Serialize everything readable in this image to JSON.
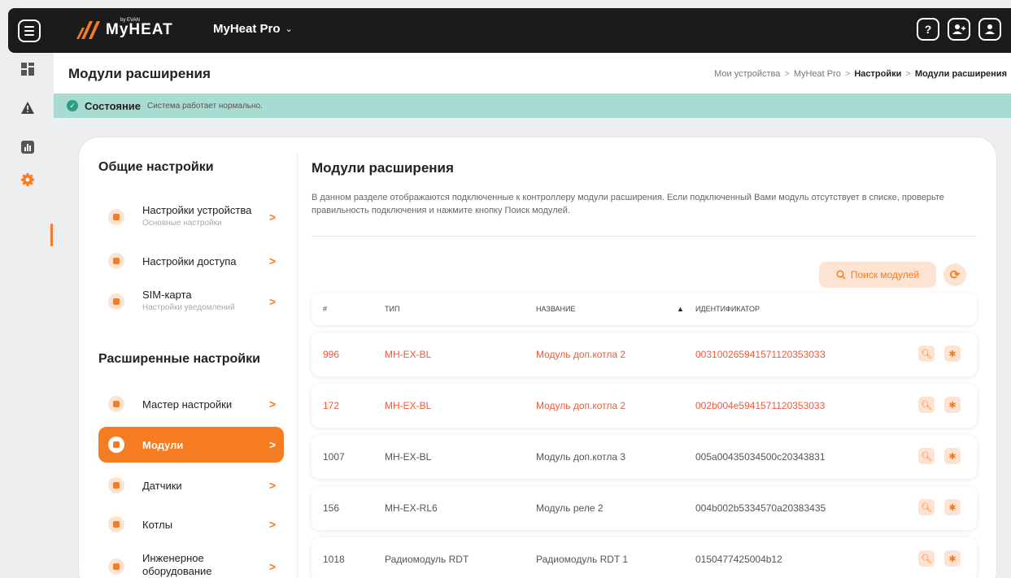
{
  "topbar": {
    "logo_text": "MyHEAT",
    "logo_sub": "by EVAN",
    "device_name": "MyHeat Pro",
    "icons": [
      "menu-icon",
      "help-icon",
      "add-user-icon",
      "user-icon"
    ],
    "help_glyph": "?"
  },
  "rail": {
    "items": [
      "dashboard-icon",
      "warning-icon",
      "chart-icon",
      "settings-icon"
    ],
    "active": "settings-icon"
  },
  "header": {
    "title": "Модули расширения",
    "breadcrumbs": [
      "Мои устройства",
      "MyHeat Pro",
      "Настройки",
      "Модули расширения"
    ],
    "separator": ">"
  },
  "status": {
    "label": "Состояние",
    "text": "Система работает нормально.",
    "color": "#a8dbd1"
  },
  "sidebar": {
    "general_title": "Общие настройки",
    "general_items": [
      {
        "label": "Настройки устройства",
        "sub": "Основные настройки"
      },
      {
        "label": "Настройки доступа",
        "sub": ""
      },
      {
        "label": "SIM-карта",
        "sub": "Настройки уведомлений"
      }
    ],
    "advanced_title": "Расширенные настройки",
    "advanced_items": [
      {
        "label": "Мастер настройки"
      },
      {
        "label": "Модули",
        "active": true
      },
      {
        "label": "Датчики"
      },
      {
        "label": "Котлы"
      },
      {
        "label": "Инженерное оборудование"
      }
    ],
    "arrow": ">"
  },
  "main": {
    "title": "Модули расширения",
    "description": "В данном разделе отображаются подключенные к контроллеру модули расширения. Если подключенный Вами модуль отсутствует в списке, проверьте правильность подключения и нажмите кнопку Поиск модулей.",
    "search_button": "Поиск модулей",
    "table": {
      "headers": [
        "#",
        "ТИП",
        "НАЗВАНИЕ",
        "ИДЕНТИФИКАТОР"
      ],
      "sort_column": "НАЗВАНИЕ",
      "rows": [
        {
          "num": "996",
          "type": "MH-EX-BL",
          "name": "Модуль доп.котла 2",
          "id": "00310026594157112035303З",
          "error": true
        },
        {
          "num": "172",
          "type": "MH-EX-BL",
          "name": "Модуль доп.котла 2",
          "id": "002b004e5941571120353033",
          "error": true
        },
        {
          "num": "1007",
          "type": "MH-EX-BL",
          "name": "Модуль доп.котла 3",
          "id": "005a00435034500c20343831",
          "error": false
        },
        {
          "num": "156",
          "type": "MH-EX-RL6",
          "name": "Модуль реле 2",
          "id": "004b002b5334570a20383435",
          "error": false
        },
        {
          "num": "1018",
          "type": "Радиомодуль RDT",
          "name": "Радиомодуль RDT 1",
          "id": "0150477425004b12",
          "error": false
        }
      ]
    }
  },
  "colors": {
    "accent": "#f57c21",
    "accent_light": "#fde3d2",
    "error": "#ef5a3c",
    "topbar": "#1b1b1b"
  }
}
